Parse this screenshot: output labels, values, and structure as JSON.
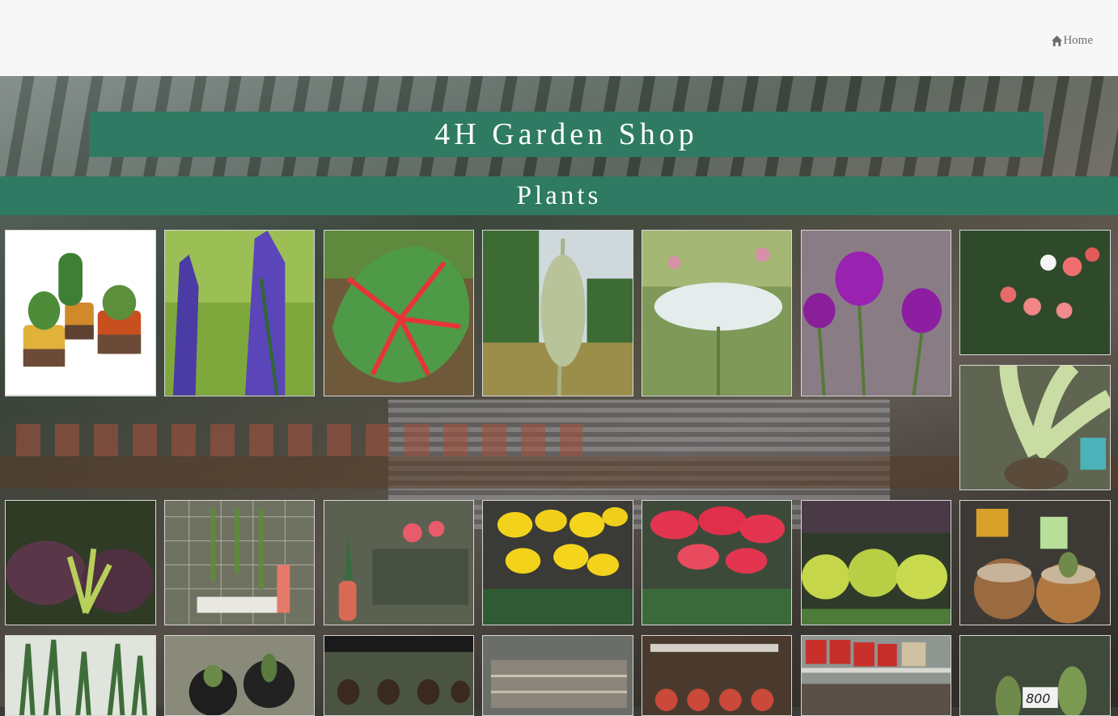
{
  "nav": {
    "home_label": "Home",
    "home_icon": "home-icon"
  },
  "header": {
    "title": "4H Garden Shop"
  },
  "section": {
    "title": "Plants"
  },
  "tiles": [
    {
      "name": "tile-cactus-pots",
      "icon": "cactus-image"
    },
    {
      "name": "tile-lupine",
      "icon": "lupine-image"
    },
    {
      "name": "tile-caladium",
      "icon": "caladium-image"
    },
    {
      "name": "tile-wild-plant",
      "icon": "wild-plant-image"
    },
    {
      "name": "tile-white-umbels",
      "icon": "white-flower-image"
    },
    {
      "name": "tile-globe-amaranth",
      "icon": "purple-flower-image"
    },
    {
      "name": "tile-camellia",
      "icon": "camellia-image"
    },
    {
      "name": "tile-birds-nest-fern",
      "icon": "fern-image"
    },
    {
      "name": "tile-purple-foliage",
      "icon": "foliage-image"
    },
    {
      "name": "tile-hanging-plants",
      "icon": "hanging-plants-image"
    },
    {
      "name": "tile-flamingo-pots",
      "icon": "flamingo-image"
    },
    {
      "name": "tile-yellow-mums",
      "icon": "mums-image"
    },
    {
      "name": "tile-poinsettia",
      "icon": "poinsettia-image"
    },
    {
      "name": "tile-yellow-shrubs",
      "icon": "shrubs-image"
    },
    {
      "name": "tile-cactus-barrels",
      "icon": "cactus-barrel-image"
    },
    {
      "name": "tile-snake-plant",
      "icon": "snake-plant-image"
    },
    {
      "name": "tile-potted-cacti",
      "icon": "potted-cacti-image"
    },
    {
      "name": "tile-hanging-pots",
      "icon": "hanging-pots-image"
    },
    {
      "name": "tile-garden-store",
      "icon": "store-image"
    },
    {
      "name": "tile-cactus-shelf",
      "icon": "cactus-shelf-image"
    },
    {
      "name": "tile-red-pots",
      "icon": "red-pots-image"
    },
    {
      "name": "tile-priced-cacti",
      "icon": "priced-cacti-image",
      "price_tag": "800"
    }
  ]
}
